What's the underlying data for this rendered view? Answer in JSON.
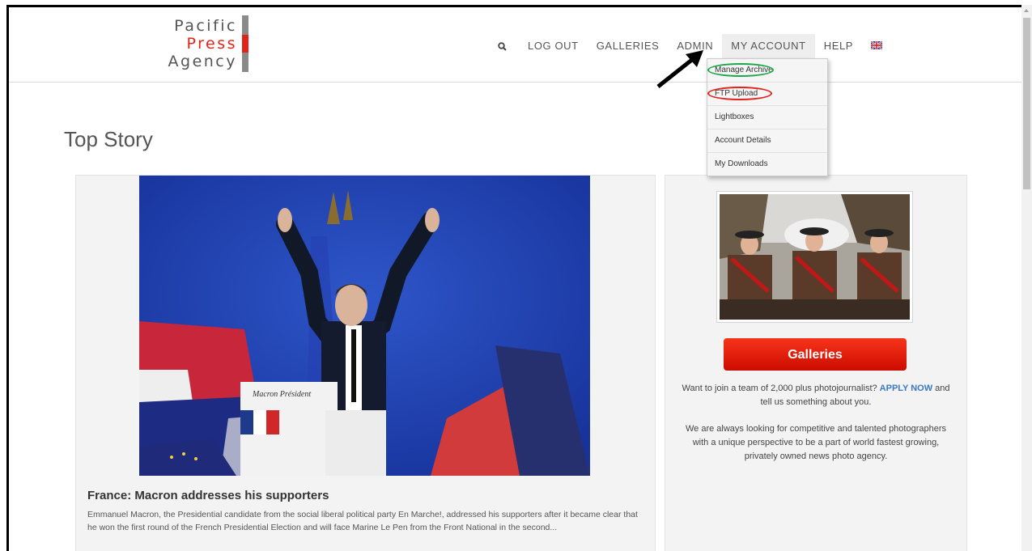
{
  "logo": {
    "line1": "Pacific",
    "line2": "Press",
    "line3": "Agency"
  },
  "nav": {
    "search_icon": "search-icon",
    "items": [
      {
        "label": "LOG OUT"
      },
      {
        "label": "GALLERIES"
      },
      {
        "label": "ADMIN"
      },
      {
        "label": "MY ACCOUNT"
      },
      {
        "label": "HELP"
      }
    ],
    "flag_icon": "uk-flag-icon"
  },
  "dropdown": {
    "items": [
      {
        "label": "Manage Archive"
      },
      {
        "label": "FTP Upload"
      },
      {
        "label": "Lightboxes"
      },
      {
        "label": "Account Details"
      },
      {
        "label": "My Downloads"
      }
    ],
    "highlight_colors": {
      "manage_archive": "#1ca84a",
      "ftp_upload": "#e2231a"
    }
  },
  "page_title": "Top Story",
  "story": {
    "podium_sign": "Macron Président",
    "headline": "France: Macron addresses his supporters",
    "summary": "Emmanuel Macron, the Presidential candidate from the social liberal political party En Marche!, addressed his supporters after it became clear that he won the first round of the French Presidential Election and will face Marine Le Pen from the Front National in the second..."
  },
  "sidebar": {
    "galleries_button": "Galleries",
    "join_text_before": "Want to join a team of 2,000 plus photojournalist? ",
    "apply_link": "APPLY NOW",
    "join_text_after": " and tell us something about you.",
    "recruit_text": "We are always looking for competitive and talented photographers with a unique perspective to be a part of world fastest growing, privately owned news photo agency."
  },
  "colors": {
    "brand_red": "#e2231a",
    "link_blue": "#3c78c3",
    "button_red": "#e81c0a"
  }
}
